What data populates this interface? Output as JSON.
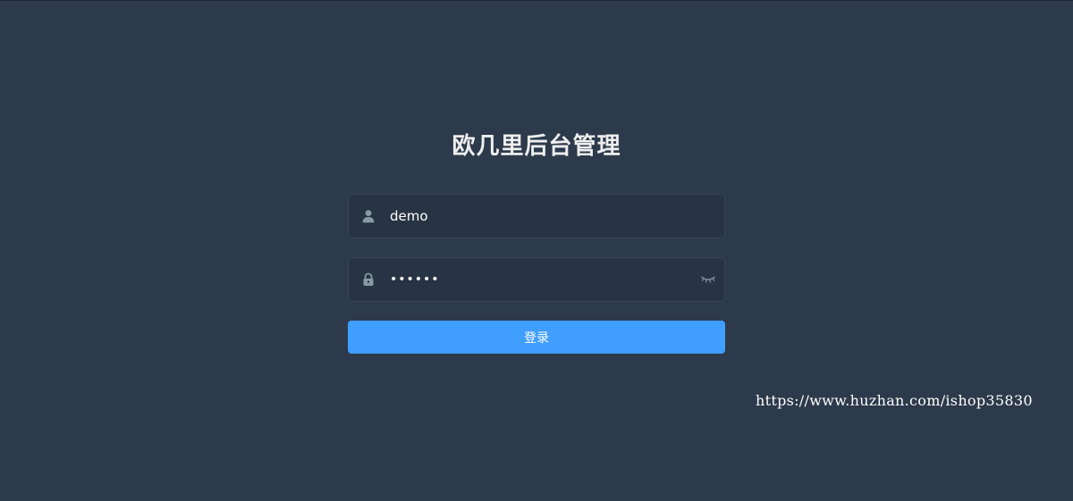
{
  "login": {
    "title": "欧几里后台管理",
    "username": {
      "value": "demo",
      "icon": "user-icon"
    },
    "password": {
      "value": "123456",
      "icon": "lock-icon",
      "toggle_icon": "eye-closed-icon"
    },
    "submit_label": "登录"
  },
  "watermark": {
    "text": "https://www.huzhan.com/ishop35830"
  },
  "colors": {
    "background": "#2d3a4b",
    "input_background": "#283443",
    "primary": "#409eff",
    "icon": "#889aa4"
  }
}
